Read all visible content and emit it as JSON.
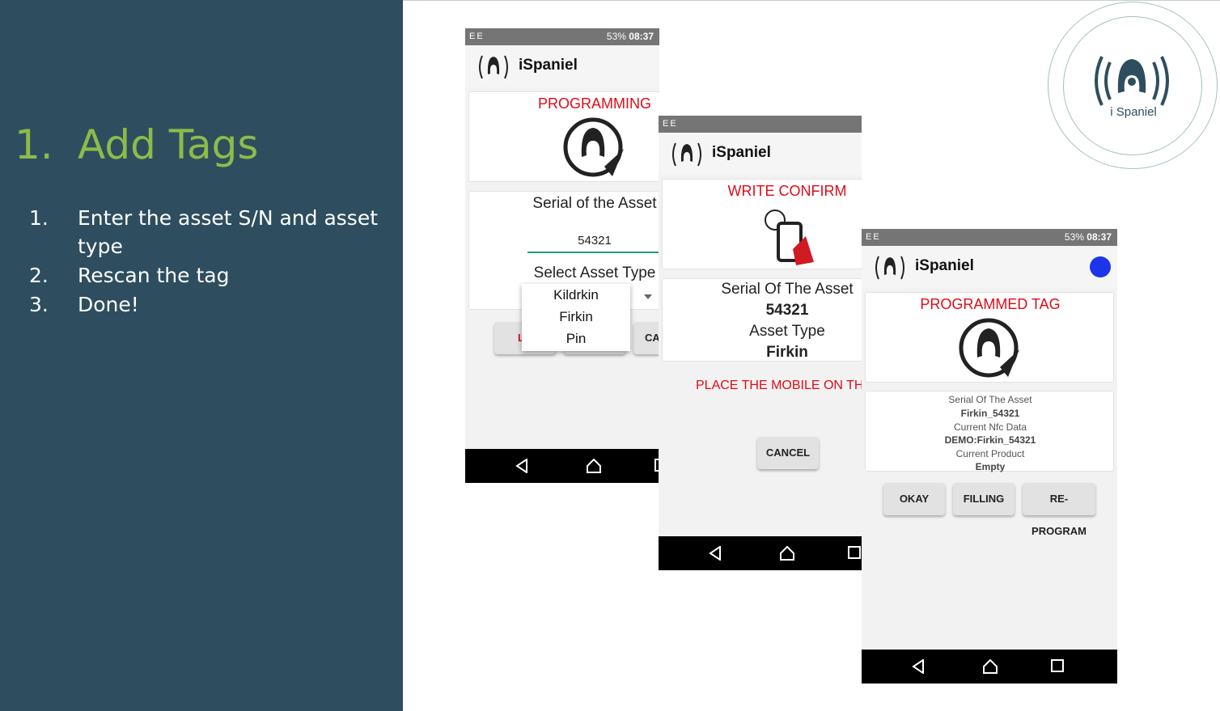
{
  "slide": {
    "title_number": "1.",
    "title": "Add Tags",
    "steps": [
      {
        "num": "1.",
        "text": "Enter the asset S/N and asset type"
      },
      {
        "num": "2.",
        "text": "Rescan the tag"
      },
      {
        "num": "3.",
        "text": "Done!"
      }
    ],
    "logo_text": "i Spaniel"
  },
  "status": {
    "carrier": "EE",
    "battery": "53%",
    "time": "08:37"
  },
  "app": {
    "name": "iSpaniel"
  },
  "screen1": {
    "heading": "PROGRAMMING",
    "serial_label": "Serial of the Asset",
    "serial_value": "54321",
    "asset_type_label": "Select Asset Type",
    "dropdown_options": [
      "Kildrkin",
      "Firkin",
      "Pin"
    ],
    "left_button_partial": "LO",
    "right_button_partial": "CA"
  },
  "screen2": {
    "heading": "WRITE CONFIRM",
    "serial_label": "Serial Of The Asset",
    "serial_value": "54321",
    "asset_type_label": "Asset Type",
    "asset_type_value": "Firkin",
    "instruction": "PLACE THE MOBILE ON THE",
    "cancel": "CANCEL"
  },
  "screen3": {
    "heading": "PROGRAMMED TAG",
    "serial_label": "Serial Of The Asset",
    "serial_value": "Firkin_54321",
    "nfc_label": "Current Nfc Data",
    "nfc_value": "DEMO:Firkin_54321",
    "product_label": "Current Product",
    "product_value": "Empty",
    "buttons": [
      "OKAY",
      "FILLING",
      "RE-PROGRAM"
    ]
  },
  "colors": {
    "panel": "#2e4e5f",
    "accent": "#8dbb4a",
    "alert": "#e00b17",
    "dot": "#1c35e8"
  }
}
